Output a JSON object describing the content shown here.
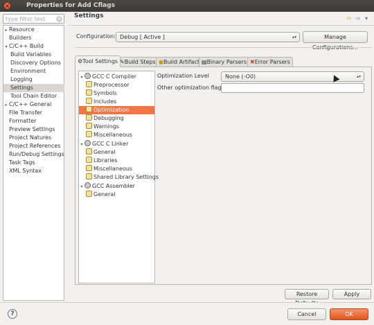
{
  "window": {
    "title": "Properties for Add Cflags",
    "close_glyph": "×"
  },
  "filter": {
    "placeholder": "type filter text",
    "clear_glyph": "×"
  },
  "nav": {
    "items": [
      {
        "label": "Resource",
        "expand": "▸"
      },
      {
        "label": "Builders",
        "expand": ""
      },
      {
        "label": "C/C++ Build",
        "expand": "▾"
      },
      {
        "label": "Build Variables",
        "expand": ""
      },
      {
        "label": "Discovery Options",
        "expand": ""
      },
      {
        "label": "Environment",
        "expand": ""
      },
      {
        "label": "Logging",
        "expand": ""
      },
      {
        "label": "Settings",
        "expand": ""
      },
      {
        "label": "Tool Chain Editor",
        "expand": ""
      },
      {
        "label": "C/C++ General",
        "expand": "▸"
      },
      {
        "label": "File Transfer",
        "expand": ""
      },
      {
        "label": "Formatter",
        "expand": ""
      },
      {
        "label": "Preview Settings",
        "expand": ""
      },
      {
        "label": "Project Natures",
        "expand": ""
      },
      {
        "label": "Project References",
        "expand": ""
      },
      {
        "label": "Run/Debug Settings",
        "expand": ""
      },
      {
        "label": "Task Tags",
        "expand": ""
      },
      {
        "label": "XML Syntax",
        "expand": ""
      }
    ],
    "selected": "Settings"
  },
  "content": {
    "title": "Settings",
    "back_glyph": "⇦",
    "forward_glyph": "⇨",
    "menu_glyph": "▾"
  },
  "configuration": {
    "label": "Configuration:",
    "value": "Debug  [ Active ]",
    "manage_label": "Manage Configurations..."
  },
  "tabs": [
    {
      "label": "Tool Settings",
      "icon": "⚙",
      "active": true
    },
    {
      "label": "Build Steps",
      "icon": "✎",
      "active": false
    },
    {
      "label": "Build Artifact",
      "icon": "●",
      "active": false
    },
    {
      "label": "Binary Parsers",
      "icon": "▤",
      "active": false
    },
    {
      "label": "Error Parsers",
      "icon": "✖",
      "active": false
    }
  ],
  "tool_tree": [
    {
      "label": "GCC C Compiler",
      "level": 0,
      "expand": "▾",
      "icon": "gear"
    },
    {
      "label": "Preprocessor",
      "level": 1,
      "icon": "tool"
    },
    {
      "label": "Symbols",
      "level": 1,
      "icon": "tool"
    },
    {
      "label": "Includes",
      "level": 1,
      "icon": "tool"
    },
    {
      "label": "Optimization",
      "level": 1,
      "icon": "tool"
    },
    {
      "label": "Debugging",
      "level": 1,
      "icon": "tool"
    },
    {
      "label": "Warnings",
      "level": 1,
      "icon": "tool"
    },
    {
      "label": "Miscellaneous",
      "level": 1,
      "icon": "tool"
    },
    {
      "label": "GCC C Linker",
      "level": 0,
      "expand": "▾",
      "icon": "gear"
    },
    {
      "label": "General",
      "level": 1,
      "icon": "tool"
    },
    {
      "label": "Libraries",
      "level": 1,
      "icon": "tool"
    },
    {
      "label": "Miscellaneous",
      "level": 1,
      "icon": "tool"
    },
    {
      "label": "Shared Library Settings",
      "level": 1,
      "icon": "tool"
    },
    {
      "label": "GCC Assembler",
      "level": 0,
      "expand": "▾",
      "icon": "gear"
    },
    {
      "label": "General",
      "level": 1,
      "icon": "tool"
    }
  ],
  "tool_tree_selected": "Optimization",
  "options": {
    "opt_level_label": "Optimization Level",
    "opt_level_value": "None (-O0)",
    "other_flags_label": "Other optimization flags",
    "other_flags_value": ""
  },
  "buttons": {
    "restore_defaults": "Restore Defaults",
    "apply": "Apply",
    "cancel": "Cancel",
    "ok": "OK",
    "help": "?"
  },
  "colors": {
    "selection": "#f07746",
    "ok_button": "#e0551e"
  }
}
